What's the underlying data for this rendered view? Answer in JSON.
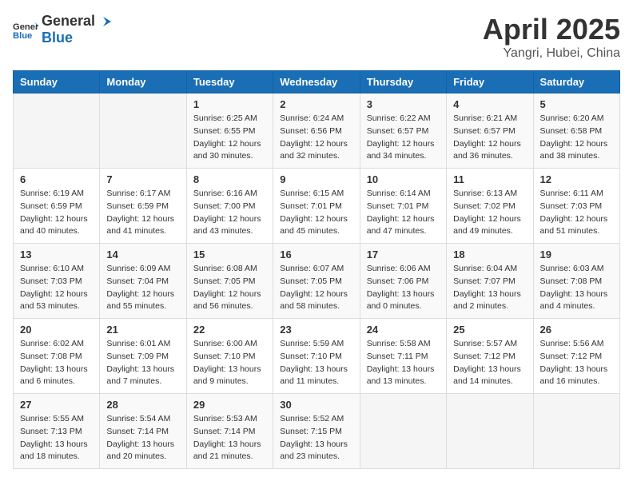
{
  "header": {
    "logo_general": "General",
    "logo_blue": "Blue",
    "month": "April 2025",
    "location": "Yangri, Hubei, China"
  },
  "weekdays": [
    "Sunday",
    "Monday",
    "Tuesday",
    "Wednesday",
    "Thursday",
    "Friday",
    "Saturday"
  ],
  "weeks": [
    [
      {
        "day": "",
        "info": ""
      },
      {
        "day": "",
        "info": ""
      },
      {
        "day": "1",
        "info": "Sunrise: 6:25 AM\nSunset: 6:55 PM\nDaylight: 12 hours\nand 30 minutes."
      },
      {
        "day": "2",
        "info": "Sunrise: 6:24 AM\nSunset: 6:56 PM\nDaylight: 12 hours\nand 32 minutes."
      },
      {
        "day": "3",
        "info": "Sunrise: 6:22 AM\nSunset: 6:57 PM\nDaylight: 12 hours\nand 34 minutes."
      },
      {
        "day": "4",
        "info": "Sunrise: 6:21 AM\nSunset: 6:57 PM\nDaylight: 12 hours\nand 36 minutes."
      },
      {
        "day": "5",
        "info": "Sunrise: 6:20 AM\nSunset: 6:58 PM\nDaylight: 12 hours\nand 38 minutes."
      }
    ],
    [
      {
        "day": "6",
        "info": "Sunrise: 6:19 AM\nSunset: 6:59 PM\nDaylight: 12 hours\nand 40 minutes."
      },
      {
        "day": "7",
        "info": "Sunrise: 6:17 AM\nSunset: 6:59 PM\nDaylight: 12 hours\nand 41 minutes."
      },
      {
        "day": "8",
        "info": "Sunrise: 6:16 AM\nSunset: 7:00 PM\nDaylight: 12 hours\nand 43 minutes."
      },
      {
        "day": "9",
        "info": "Sunrise: 6:15 AM\nSunset: 7:01 PM\nDaylight: 12 hours\nand 45 minutes."
      },
      {
        "day": "10",
        "info": "Sunrise: 6:14 AM\nSunset: 7:01 PM\nDaylight: 12 hours\nand 47 minutes."
      },
      {
        "day": "11",
        "info": "Sunrise: 6:13 AM\nSunset: 7:02 PM\nDaylight: 12 hours\nand 49 minutes."
      },
      {
        "day": "12",
        "info": "Sunrise: 6:11 AM\nSunset: 7:03 PM\nDaylight: 12 hours\nand 51 minutes."
      }
    ],
    [
      {
        "day": "13",
        "info": "Sunrise: 6:10 AM\nSunset: 7:03 PM\nDaylight: 12 hours\nand 53 minutes."
      },
      {
        "day": "14",
        "info": "Sunrise: 6:09 AM\nSunset: 7:04 PM\nDaylight: 12 hours\nand 55 minutes."
      },
      {
        "day": "15",
        "info": "Sunrise: 6:08 AM\nSunset: 7:05 PM\nDaylight: 12 hours\nand 56 minutes."
      },
      {
        "day": "16",
        "info": "Sunrise: 6:07 AM\nSunset: 7:05 PM\nDaylight: 12 hours\nand 58 minutes."
      },
      {
        "day": "17",
        "info": "Sunrise: 6:06 AM\nSunset: 7:06 PM\nDaylight: 13 hours\nand 0 minutes."
      },
      {
        "day": "18",
        "info": "Sunrise: 6:04 AM\nSunset: 7:07 PM\nDaylight: 13 hours\nand 2 minutes."
      },
      {
        "day": "19",
        "info": "Sunrise: 6:03 AM\nSunset: 7:08 PM\nDaylight: 13 hours\nand 4 minutes."
      }
    ],
    [
      {
        "day": "20",
        "info": "Sunrise: 6:02 AM\nSunset: 7:08 PM\nDaylight: 13 hours\nand 6 minutes."
      },
      {
        "day": "21",
        "info": "Sunrise: 6:01 AM\nSunset: 7:09 PM\nDaylight: 13 hours\nand 7 minutes."
      },
      {
        "day": "22",
        "info": "Sunrise: 6:00 AM\nSunset: 7:10 PM\nDaylight: 13 hours\nand 9 minutes."
      },
      {
        "day": "23",
        "info": "Sunrise: 5:59 AM\nSunset: 7:10 PM\nDaylight: 13 hours\nand 11 minutes."
      },
      {
        "day": "24",
        "info": "Sunrise: 5:58 AM\nSunset: 7:11 PM\nDaylight: 13 hours\nand 13 minutes."
      },
      {
        "day": "25",
        "info": "Sunrise: 5:57 AM\nSunset: 7:12 PM\nDaylight: 13 hours\nand 14 minutes."
      },
      {
        "day": "26",
        "info": "Sunrise: 5:56 AM\nSunset: 7:12 PM\nDaylight: 13 hours\nand 16 minutes."
      }
    ],
    [
      {
        "day": "27",
        "info": "Sunrise: 5:55 AM\nSunset: 7:13 PM\nDaylight: 13 hours\nand 18 minutes."
      },
      {
        "day": "28",
        "info": "Sunrise: 5:54 AM\nSunset: 7:14 PM\nDaylight: 13 hours\nand 20 minutes."
      },
      {
        "day": "29",
        "info": "Sunrise: 5:53 AM\nSunset: 7:14 PM\nDaylight: 13 hours\nand 21 minutes."
      },
      {
        "day": "30",
        "info": "Sunrise: 5:52 AM\nSunset: 7:15 PM\nDaylight: 13 hours\nand 23 minutes."
      },
      {
        "day": "",
        "info": ""
      },
      {
        "day": "",
        "info": ""
      },
      {
        "day": "",
        "info": ""
      }
    ]
  ]
}
